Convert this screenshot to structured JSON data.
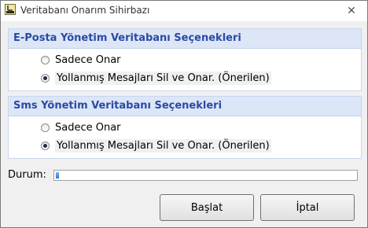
{
  "window": {
    "title": "Veritabanı Onarım Sihirbazı",
    "close_glyph": "✕",
    "icon": "app-icon"
  },
  "email_group": {
    "header": "E-Posta Yönetim Veritabanı Seçenekleri",
    "options": [
      {
        "label": "Sadece Onar",
        "checked": false
      },
      {
        "label": "Yollanmış Mesajları Sil ve Onar. (Önerilen)",
        "checked": true
      }
    ]
  },
  "sms_group": {
    "header": "Sms Yönetim Veritabanı Seçenekleri",
    "options": [
      {
        "label": "Sadece Onar",
        "checked": false
      },
      {
        "label": "Yollanmış Mesajları Sil ve Onar. (Önerilen)",
        "checked": true
      }
    ]
  },
  "status": {
    "label": "Durum:",
    "progress_fraction": 0.01
  },
  "buttons": {
    "start": "Başlat",
    "cancel": "İptal"
  },
  "colors": {
    "group_header_text": "#2a4aa3",
    "group_header_bg": "#dce6f7",
    "progress_fill": "#2f74d6"
  }
}
